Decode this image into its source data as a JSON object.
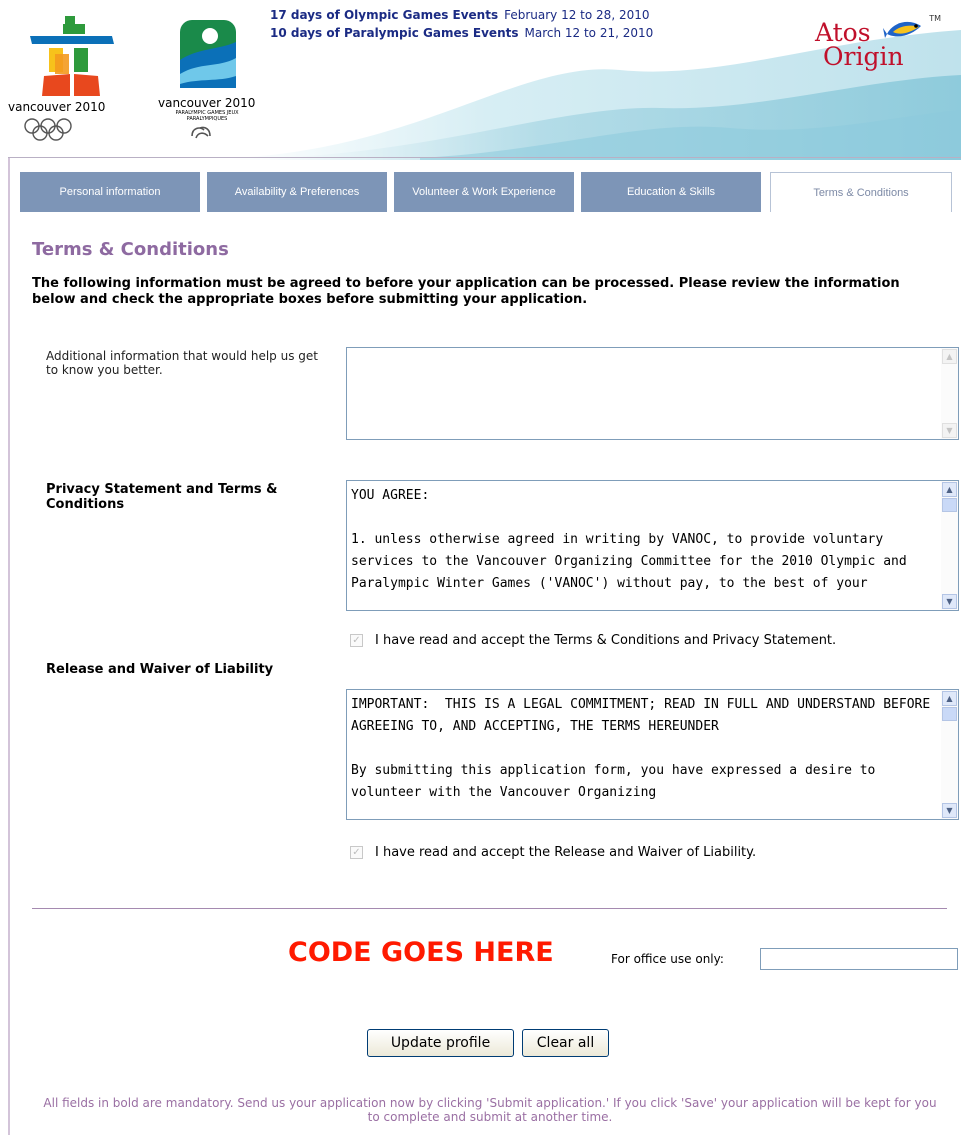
{
  "header": {
    "olympic_logo_caption": "vancouver 2010",
    "paralympic_logo_caption": "vancouver 2010",
    "paralympic_logo_subtitle": "PARALYMPIC GAMES JEUX PARALYMPIQUES",
    "olympic_events_label": "17 days of Olympic Games Events",
    "olympic_events_dates": "February 12 to 28, 2010",
    "paralympic_events_label": "10 days of Paralympic Games Events",
    "paralympic_events_dates": "March 12 to 21, 2010",
    "sponsor_word_1": "Atos",
    "sponsor_word_2": "Origin",
    "sponsor_tm": "TM"
  },
  "tabs": [
    {
      "label": "Personal information",
      "active": false
    },
    {
      "label": "Availability & Preferences",
      "active": false
    },
    {
      "label": "Volunteer & Work Experience",
      "active": false
    },
    {
      "label": "Education & Skills",
      "active": false
    },
    {
      "label": "Terms & Conditions",
      "active": true
    }
  ],
  "form": {
    "title": "Terms & Conditions",
    "intro": "The following information must be agreed to before your application can be processed. Please review the information below and check the appropriate boxes before submitting your application.",
    "additional_info_label": "Additional information that would help us get to know you better.",
    "additional_info_value": "",
    "privacy_label": "Privacy Statement and Terms & Conditions",
    "privacy_text": "YOU AGREE:\n\n1. unless otherwise agreed in writing by VANOC, to provide voluntary services to the Vancouver Organizing Committee for the 2010 Olympic and Paralympic Winter Games ('VANOC') without pay, to the best of your",
    "privacy_accept_label": "I have read and accept the Terms & Conditions and Privacy Statement.",
    "privacy_accept_checked": true,
    "release_label": "Release and Waiver of Liability",
    "release_text": "IMPORTANT:  THIS IS A LEGAL COMMITMENT; READ IN FULL AND UNDERSTAND BEFORE AGREEING TO, AND ACCEPTING, THE TERMS HEREUNDER\n\nBy submitting this application form, you have expressed a desire to volunteer with the Vancouver Organizing",
    "release_accept_label": "I have read and accept the Release and Waiver of Liability.",
    "release_accept_checked": true,
    "code_placeholder_text": "CODE GOES HERE",
    "office_use_label": "For office use only:",
    "office_use_value": "",
    "update_button": "Update profile",
    "clear_button": "Clear all",
    "footer_note": "All fields in bold are mandatory. Send us your application now by clicking 'Submit application.' If you click 'Save' your application will be kept for you to complete and submit at another time."
  },
  "colors": {
    "tab_bg": "#7d95b7",
    "title_purple": "#8e6aa1",
    "code_red": "#ff1a00",
    "sponsor_red": "#c0102b",
    "header_text_navy": "#1b2b84",
    "footer_purple": "#9a6fa3"
  },
  "icons": {
    "checkbox": "check-icon",
    "scroll_up": "arrow-up-icon",
    "scroll_down": "arrow-down-icon"
  }
}
